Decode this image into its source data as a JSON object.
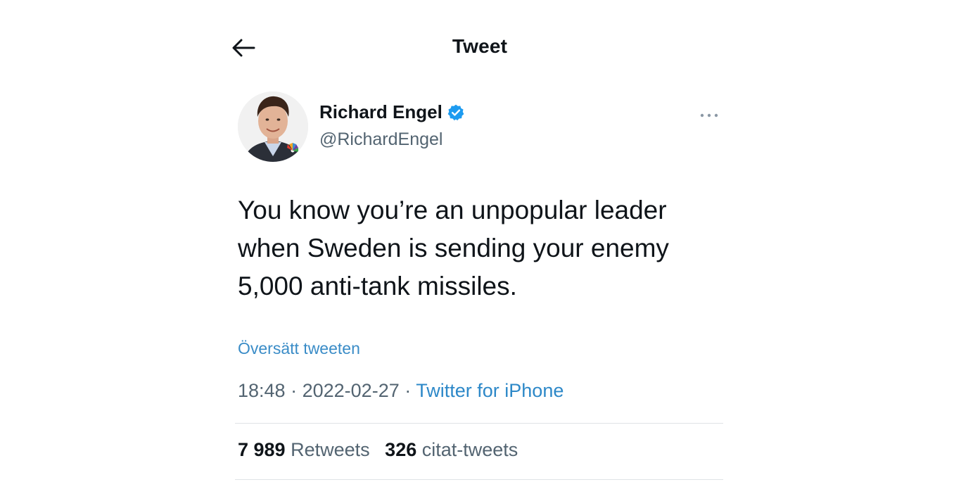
{
  "header": {
    "title": "Tweet",
    "back_icon": "arrow-left-icon"
  },
  "author": {
    "display_name": "Richard Engel",
    "handle": "@RichardEngel",
    "verified_icon": "verified-badge-icon",
    "verified_color": "#1d9bf0",
    "more_icon": "ellipsis-icon"
  },
  "tweet": {
    "text_lines": [
      "You know you’re an unpopular leader",
      "when Sweden is sending your enemy",
      "5,000 anti-tank missiles."
    ],
    "translate_label": "Översätt tweeten",
    "time": "18:48",
    "date": "2022-02-27",
    "separator": "·",
    "source": "Twitter for iPhone"
  },
  "stats": {
    "retweets_count": "7 989",
    "retweets_label": "Retweets",
    "quotes_count": "326",
    "quotes_label": "citat-tweets"
  },
  "colors": {
    "link": "#3a8cc7",
    "text": "#0f1419",
    "secondary": "#536471"
  }
}
